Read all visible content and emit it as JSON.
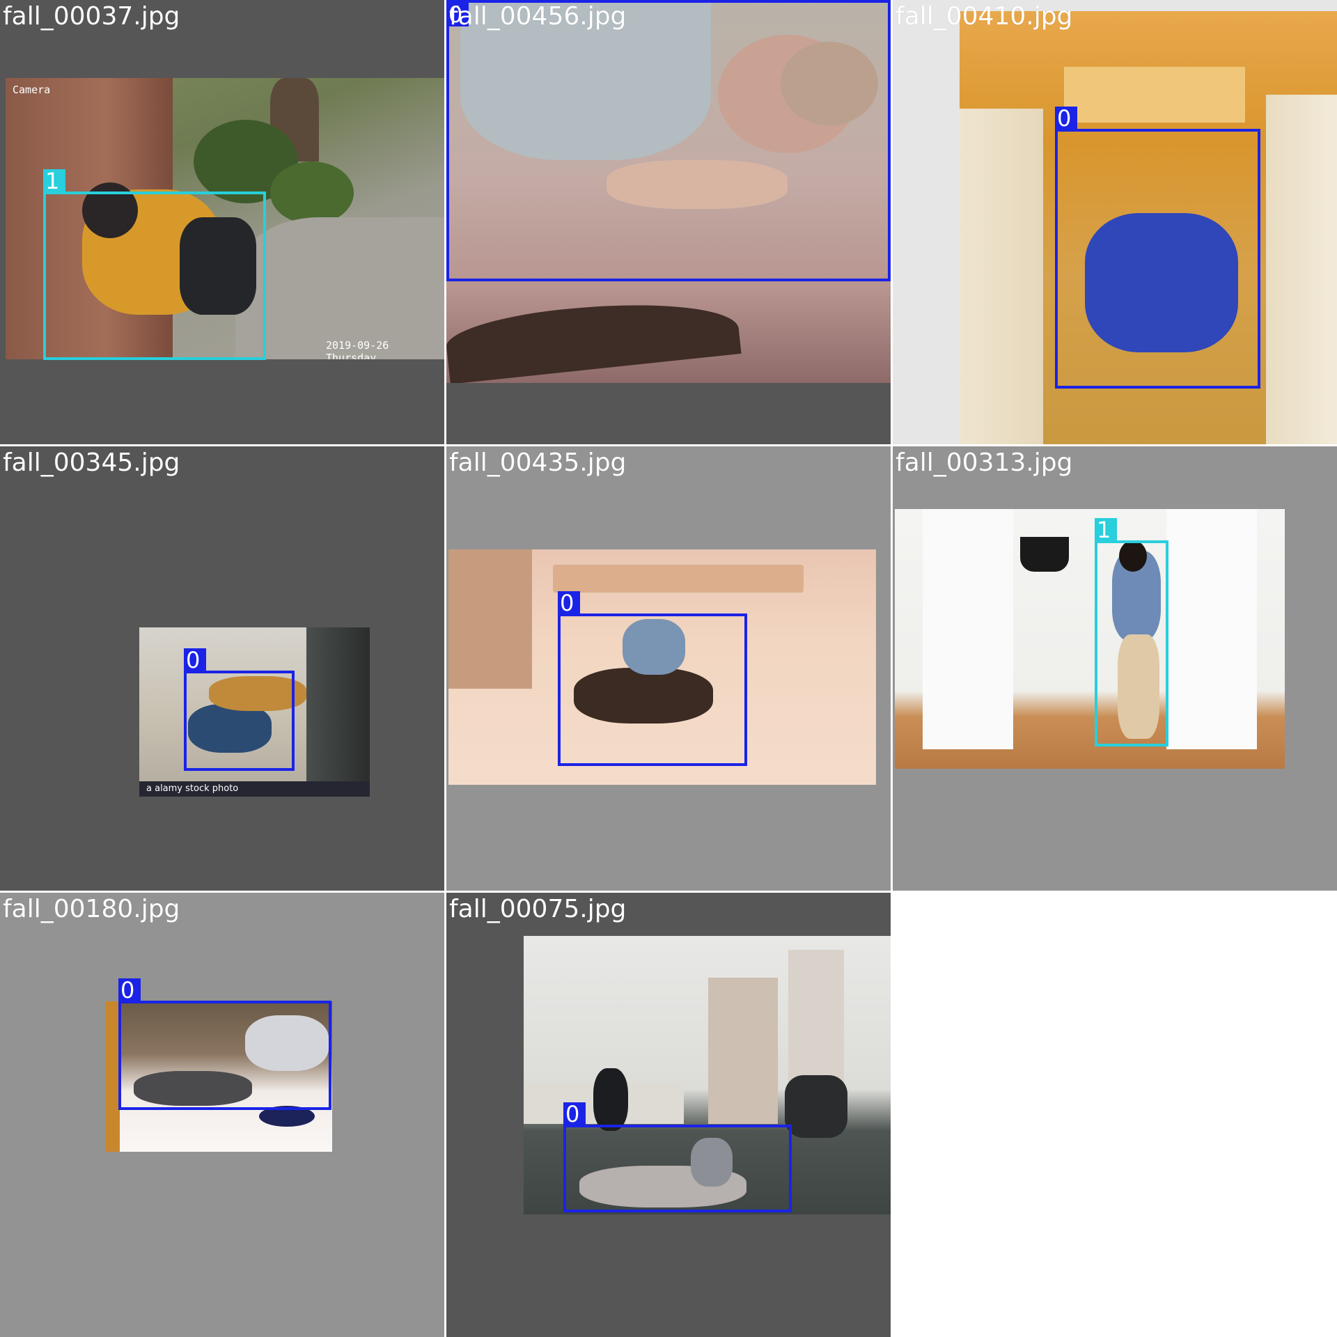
{
  "tiles": [
    {
      "filename": "fall_00037.jpg",
      "boxes": [
        {
          "label": "1"
        }
      ],
      "overlay_texts": [
        "Camera",
        "2019-09-26 Thursday"
      ]
    },
    {
      "filename": "fall_00456.jpg",
      "boxes": [
        {
          "label": "0"
        }
      ]
    },
    {
      "filename": "fall_00410.jpg",
      "boxes": [
        {
          "label": "0"
        }
      ]
    },
    {
      "filename": "fall_00345.jpg",
      "boxes": [
        {
          "label": "0"
        }
      ],
      "overlay_texts": [
        "a alamy stock photo"
      ]
    },
    {
      "filename": "fall_00435.jpg",
      "boxes": [
        {
          "label": "0"
        }
      ]
    },
    {
      "filename": "fall_00313.jpg",
      "boxes": [
        {
          "label": "1"
        }
      ]
    },
    {
      "filename": "fall_00180.jpg",
      "boxes": [
        {
          "label": "0"
        }
      ]
    },
    {
      "filename": "fall_00075.jpg",
      "boxes": [
        {
          "label": "0"
        }
      ]
    }
  ],
  "colors": {
    "class_0": "#1a23e6",
    "class_1": "#28cfdc",
    "dark_pad": "#565656",
    "light_pad": "#939393"
  }
}
